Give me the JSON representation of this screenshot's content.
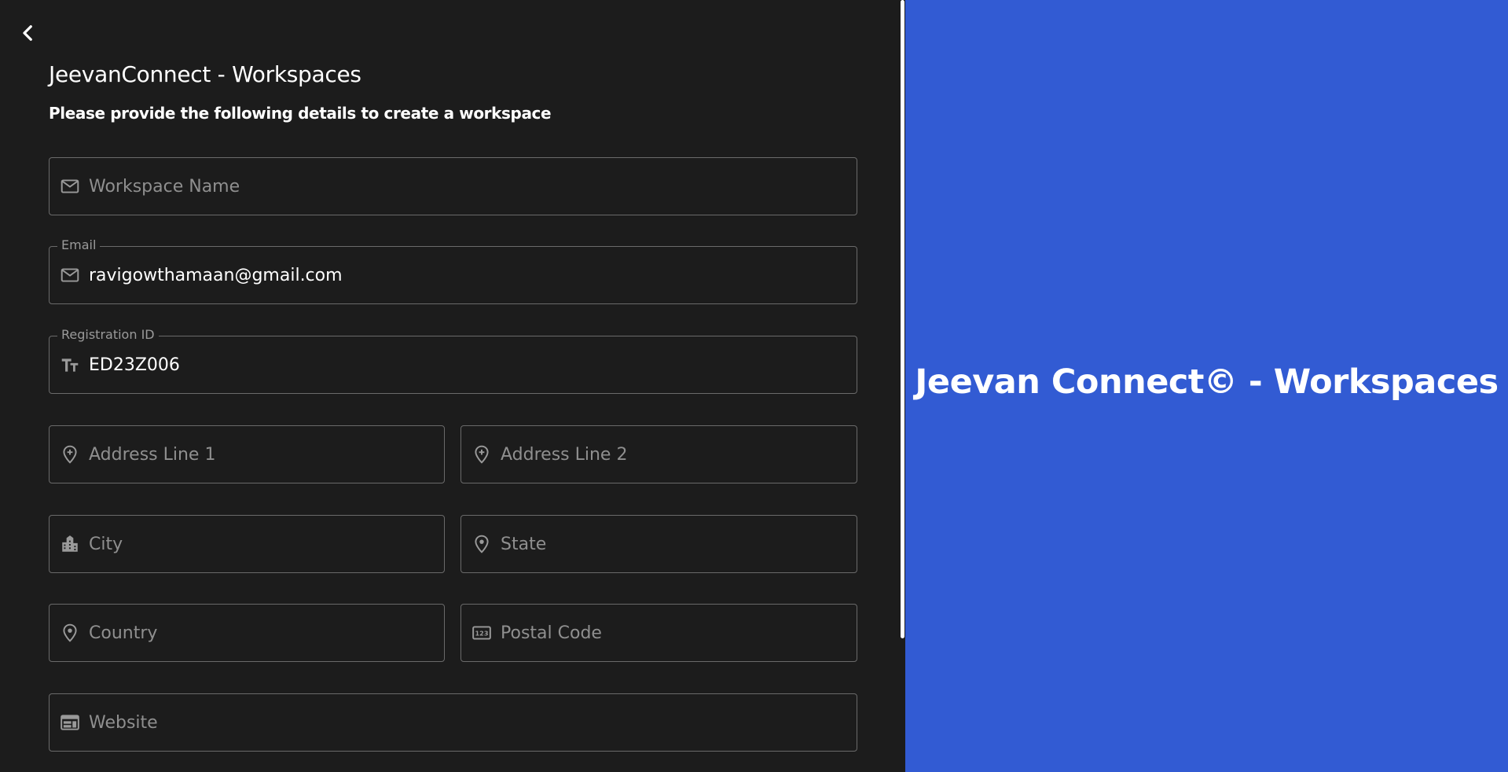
{
  "header": {
    "title": "JeevanConnect - Workspaces",
    "subtitle": "Please provide the following details to create a workspace"
  },
  "form": {
    "workspace_name": {
      "placeholder": "Workspace Name",
      "value": ""
    },
    "email": {
      "label": "Email",
      "value": "ravigowthamaan@gmail.com"
    },
    "registration_id": {
      "label": "Registration ID",
      "value": "ED23Z006"
    },
    "address_line_1": {
      "placeholder": "Address Line 1",
      "value": ""
    },
    "address_line_2": {
      "placeholder": "Address Line 2",
      "value": ""
    },
    "city": {
      "placeholder": "City",
      "value": ""
    },
    "state": {
      "placeholder": "State",
      "value": ""
    },
    "country": {
      "placeholder": "Country",
      "value": ""
    },
    "postal_code": {
      "placeholder": "Postal Code",
      "value": ""
    },
    "website": {
      "placeholder": "Website",
      "value": ""
    }
  },
  "brand_panel": {
    "heading": "Jeevan Connect© - Workspaces"
  },
  "icons": {
    "back": "chevron-left-icon",
    "workspace_name": "mail-icon",
    "email": "mail-icon",
    "registration_id": "text-fields-icon",
    "address_line_1": "add-location-icon",
    "address_line_2": "add-location-icon",
    "city": "location-city-icon",
    "state": "location-pin-icon",
    "country": "location-pin-icon",
    "postal_code": "pin-123-icon",
    "website": "web-icon"
  },
  "colors": {
    "background": "#1c1c1c",
    "accent_panel": "#325bd3",
    "field_border": "#6a6a6a",
    "placeholder": "#8f8f8f",
    "text": "#ffffff"
  }
}
